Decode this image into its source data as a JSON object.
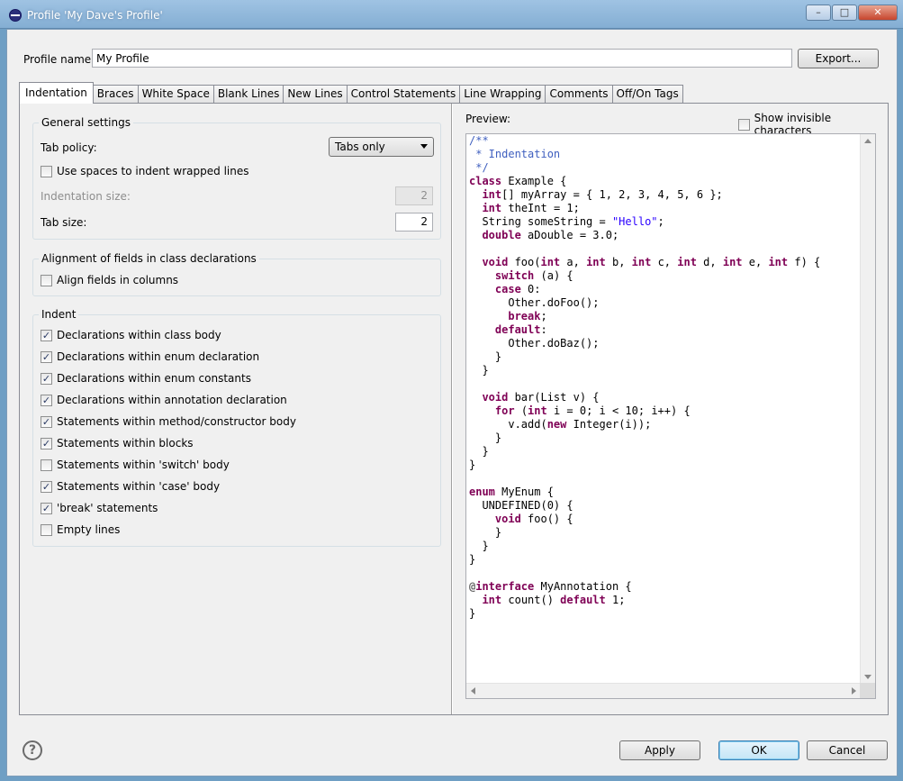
{
  "window": {
    "title": "Profile 'My Dave's Profile'",
    "controls": {
      "minimize": "–",
      "maximize": "□",
      "close": "✕"
    }
  },
  "profile": {
    "label": "Profile name:",
    "value": "My Profile",
    "export_label": "Export..."
  },
  "tabs": [
    {
      "label": "Indentation",
      "active": true
    },
    {
      "label": "Braces"
    },
    {
      "label": "White Space"
    },
    {
      "label": "Blank Lines"
    },
    {
      "label": "New Lines"
    },
    {
      "label": "Control Statements"
    },
    {
      "label": "Line Wrapping"
    },
    {
      "label": "Comments"
    },
    {
      "label": "Off/On Tags"
    }
  ],
  "general": {
    "title": "General settings",
    "tab_policy_label": "Tab policy:",
    "tab_policy_value": "Tabs only",
    "use_spaces_label": "Use spaces to indent wrapped lines",
    "indent_size_label": "Indentation size:",
    "indent_size_value": "2",
    "tab_size_label": "Tab size:",
    "tab_size_value": "2"
  },
  "alignment": {
    "title": "Alignment of fields in class declarations",
    "align_label": "Align fields in columns"
  },
  "indent": {
    "title": "Indent",
    "items": [
      {
        "label": "Declarations within class body",
        "checked": "✓"
      },
      {
        "label": "Declarations within enum declaration",
        "checked": "✓"
      },
      {
        "label": "Declarations within enum constants",
        "checked": "✓"
      },
      {
        "label": "Declarations within annotation declaration",
        "checked": "✓"
      },
      {
        "label": "Statements within method/constructor body",
        "checked": "✓"
      },
      {
        "label": "Statements within blocks",
        "checked": "✓"
      },
      {
        "label": "Statements within 'switch' body",
        "checked": ""
      },
      {
        "label": "Statements within 'case' body",
        "checked": "✓"
      },
      {
        "label": "'break' statements",
        "checked": "✓"
      },
      {
        "label": "Empty lines",
        "checked": ""
      }
    ]
  },
  "preview": {
    "label": "Preview:",
    "show_invisible_label": "Show invisible characters",
    "colors": {
      "keyword": "#7f0055",
      "comment": "#3f5fbf",
      "string": "#2a00ff",
      "annotation": "#646464"
    },
    "code": [
      [
        [
          "c",
          "/**"
        ]
      ],
      [
        [
          "c",
          " * Indentation"
        ]
      ],
      [
        [
          "c",
          " */"
        ]
      ],
      [
        [
          "k",
          "class"
        ],
        [
          "p",
          " Example {"
        ]
      ],
      [
        [
          "p",
          "  "
        ],
        [
          "k",
          "int"
        ],
        [
          "p",
          "[] myArray = { 1, 2, 3, 4, 5, 6 };"
        ]
      ],
      [
        [
          "p",
          "  "
        ],
        [
          "k",
          "int"
        ],
        [
          "p",
          " theInt = 1;"
        ]
      ],
      [
        [
          "p",
          "  String someString = "
        ],
        [
          "s",
          "\"Hello\""
        ],
        [
          "p",
          ";"
        ]
      ],
      [
        [
          "p",
          "  "
        ],
        [
          "k",
          "double"
        ],
        [
          "p",
          " aDouble = 3.0;"
        ]
      ],
      [
        [
          "p",
          ""
        ]
      ],
      [
        [
          "p",
          "  "
        ],
        [
          "k",
          "void"
        ],
        [
          "p",
          " foo("
        ],
        [
          "k",
          "int"
        ],
        [
          "p",
          " a, "
        ],
        [
          "k",
          "int"
        ],
        [
          "p",
          " b, "
        ],
        [
          "k",
          "int"
        ],
        [
          "p",
          " c, "
        ],
        [
          "k",
          "int"
        ],
        [
          "p",
          " d, "
        ],
        [
          "k",
          "int"
        ],
        [
          "p",
          " e, "
        ],
        [
          "k",
          "int"
        ],
        [
          "p",
          " f) {"
        ]
      ],
      [
        [
          "p",
          "    "
        ],
        [
          "k",
          "switch"
        ],
        [
          "p",
          " (a) {"
        ]
      ],
      [
        [
          "p",
          "    "
        ],
        [
          "k",
          "case"
        ],
        [
          "p",
          " 0:"
        ]
      ],
      [
        [
          "p",
          "      Other.doFoo();"
        ]
      ],
      [
        [
          "p",
          "      "
        ],
        [
          "k",
          "break"
        ],
        [
          "p",
          ";"
        ]
      ],
      [
        [
          "p",
          "    "
        ],
        [
          "k",
          "default"
        ],
        [
          "p",
          ":"
        ]
      ],
      [
        [
          "p",
          "      Other.doBaz();"
        ]
      ],
      [
        [
          "p",
          "    }"
        ]
      ],
      [
        [
          "p",
          "  }"
        ]
      ],
      [
        [
          "p",
          ""
        ]
      ],
      [
        [
          "p",
          "  "
        ],
        [
          "k",
          "void"
        ],
        [
          "p",
          " bar(List v) {"
        ]
      ],
      [
        [
          "p",
          "    "
        ],
        [
          "k",
          "for"
        ],
        [
          "p",
          " ("
        ],
        [
          "k",
          "int"
        ],
        [
          "p",
          " i = 0; i < 10; i++) {"
        ]
      ],
      [
        [
          "p",
          "      v.add("
        ],
        [
          "k",
          "new"
        ],
        [
          "p",
          " Integer(i));"
        ]
      ],
      [
        [
          "p",
          "    }"
        ]
      ],
      [
        [
          "p",
          "  }"
        ]
      ],
      [
        [
          "p",
          "}"
        ]
      ],
      [
        [
          "p",
          ""
        ]
      ],
      [
        [
          "k",
          "enum"
        ],
        [
          "p",
          " MyEnum {"
        ]
      ],
      [
        [
          "p",
          "  UNDEFINED(0) {"
        ]
      ],
      [
        [
          "p",
          "    "
        ],
        [
          "k",
          "void"
        ],
        [
          "p",
          " foo() {"
        ]
      ],
      [
        [
          "p",
          "    }"
        ]
      ],
      [
        [
          "p",
          "  }"
        ]
      ],
      [
        [
          "p",
          "}"
        ]
      ],
      [
        [
          "p",
          ""
        ]
      ],
      [
        [
          "a",
          "@"
        ],
        [
          "k",
          "interface"
        ],
        [
          "p",
          " MyAnnotation {"
        ]
      ],
      [
        [
          "p",
          "  "
        ],
        [
          "k",
          "int"
        ],
        [
          "p",
          " count() "
        ],
        [
          "k",
          "default"
        ],
        [
          "p",
          " 1;"
        ]
      ],
      [
        [
          "p",
          "}"
        ]
      ]
    ]
  },
  "buttons": {
    "help": "?",
    "apply": "Apply",
    "ok": "OK",
    "cancel": "Cancel"
  }
}
